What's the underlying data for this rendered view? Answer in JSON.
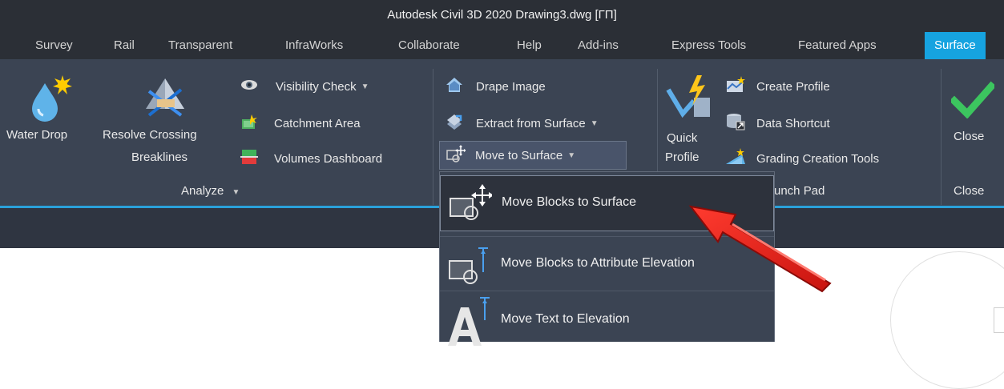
{
  "app": {
    "title": "Autodesk Civil 3D 2020    Drawing3.dwg [ГП]"
  },
  "tabs": [
    {
      "label": "Survey"
    },
    {
      "label": "Rail"
    },
    {
      "label": "Transparent"
    },
    {
      "label": "InfraWorks"
    },
    {
      "label": "Collaborate"
    },
    {
      "label": "Help"
    },
    {
      "label": "Add-ins"
    },
    {
      "label": "Express Tools"
    },
    {
      "label": "Featured Apps"
    },
    {
      "label": "Surface",
      "active": true
    }
  ],
  "analyze": {
    "water_drop": "Water Drop",
    "resolve_line1": "Resolve Crossing",
    "resolve_line2": "Breaklines",
    "visibility_check": "Visibility Check",
    "catchment_area": "Catchment Area",
    "volumes_dashboard": "Volumes Dashboard",
    "panel_title": "Analyze"
  },
  "surface_tools": {
    "drape_image": "Drape Image",
    "extract_from_surface": "Extract from Surface",
    "move_to_surface": "Move to Surface"
  },
  "launch_pad": {
    "quick_line1": "Quick",
    "quick_line2": "Profile",
    "create_profile": "Create Profile",
    "data_shortcut": "Data Shortcut",
    "grading_creation_tools": "Grading Creation Tools",
    "panel_title_partial": "unch Pad"
  },
  "close": {
    "button_label": "Close",
    "panel_title": "Close"
  },
  "dropdown": {
    "items": [
      {
        "label": "Move Blocks to Surface"
      },
      {
        "label": "Move Blocks to Attribute Elevation"
      },
      {
        "label": "Move Text to Elevation"
      }
    ]
  },
  "colors": {
    "accent_tab": "#16a3e0",
    "ribbon_bg": "#3b4453",
    "arrow": "#e0231d"
  }
}
